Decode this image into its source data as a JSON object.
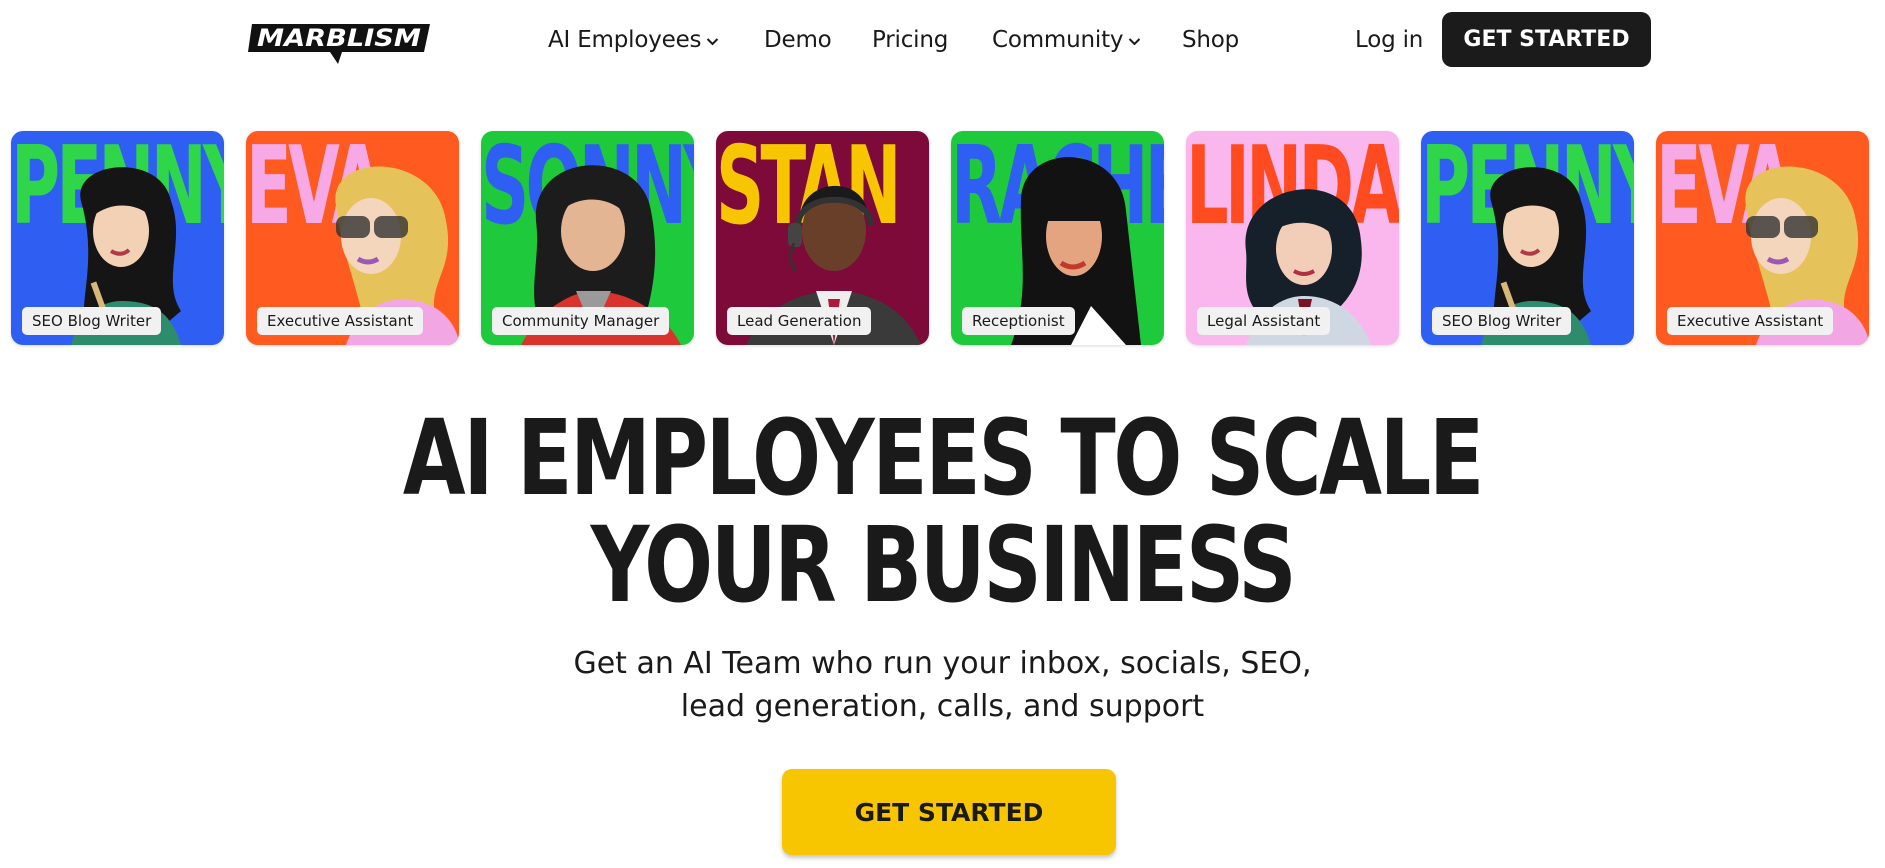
{
  "brand": {
    "logo_text": "MARBLISM"
  },
  "nav": {
    "links": [
      {
        "label": "AI Employees",
        "has_dropdown": true
      },
      {
        "label": "Demo",
        "has_dropdown": false
      },
      {
        "label": "Pricing",
        "has_dropdown": false
      },
      {
        "label": "Community",
        "has_dropdown": true
      },
      {
        "label": "Shop",
        "has_dropdown": false
      }
    ],
    "login_label": "Log in",
    "cta_label": "GET STARTED"
  },
  "employees": [
    {
      "name": "PENNY",
      "role": "SEO Blog Writer",
      "bg": "#2f5ff2",
      "name_color": "#2fd64a"
    },
    {
      "name": "EVA",
      "role": "Executive Assistant",
      "bg": "#ff5a1f",
      "name_color": "#f7a9e6"
    },
    {
      "name": "SONNY",
      "role": "Community Manager",
      "bg": "#1fc93c",
      "name_color": "#2f5ff2"
    },
    {
      "name": "STAN",
      "role": "Lead Generation",
      "bg": "#7e0a3a",
      "name_color": "#f7c600"
    },
    {
      "name": "RACHEL",
      "role": "Receptionist",
      "bg": "#1fc93c",
      "name_color": "#2f5ff2"
    },
    {
      "name": "LINDA",
      "role": "Legal Assistant",
      "bg": "#f9b7ee",
      "name_color": "#ff4b1f"
    },
    {
      "name": "PENNY",
      "role": "SEO Blog Writer",
      "bg": "#2f5ff2",
      "name_color": "#2fd64a"
    },
    {
      "name": "EVA",
      "role": "Executive Assistant",
      "bg": "#ff5a1f",
      "name_color": "#f7a9e6"
    }
  ],
  "hero": {
    "title_line1": "AI EMPLOYEES TO SCALE",
    "title_line2": "YOUR BUSINESS",
    "subtitle_line1": "Get an AI Team who run your inbox, socials, SEO,",
    "subtitle_line2": "lead generation, calls, and support",
    "cta_label": "GET STARTED"
  },
  "colors": {
    "accent": "#f7c600",
    "dark": "#1b1b1b",
    "text": "#1a1a1a"
  }
}
